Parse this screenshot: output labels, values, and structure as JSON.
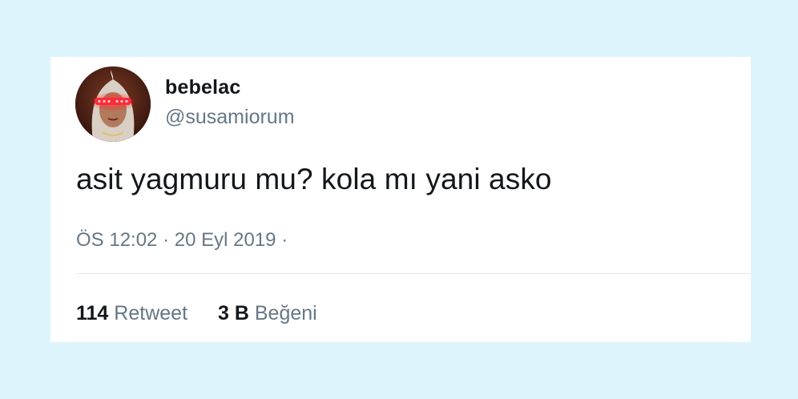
{
  "tweet": {
    "display_name": "bebelac",
    "handle": "@susamiorum",
    "text": "asit yagmuru mu? kola mı yani asko",
    "time": "ÖS 12:02",
    "separator": "·",
    "date": "20 Eyl 2019",
    "trailing_separator": "·",
    "retweet_count": "114",
    "retweet_label": "Retweet",
    "like_count": "3 B",
    "like_label": "Beğeni"
  },
  "colors": {
    "background": "#def4fc",
    "card": "#ffffff",
    "text_primary": "#14171a",
    "text_secondary": "#657786",
    "divider": "#e1e8ed",
    "avatar_glasses": "#ff2a3a"
  }
}
